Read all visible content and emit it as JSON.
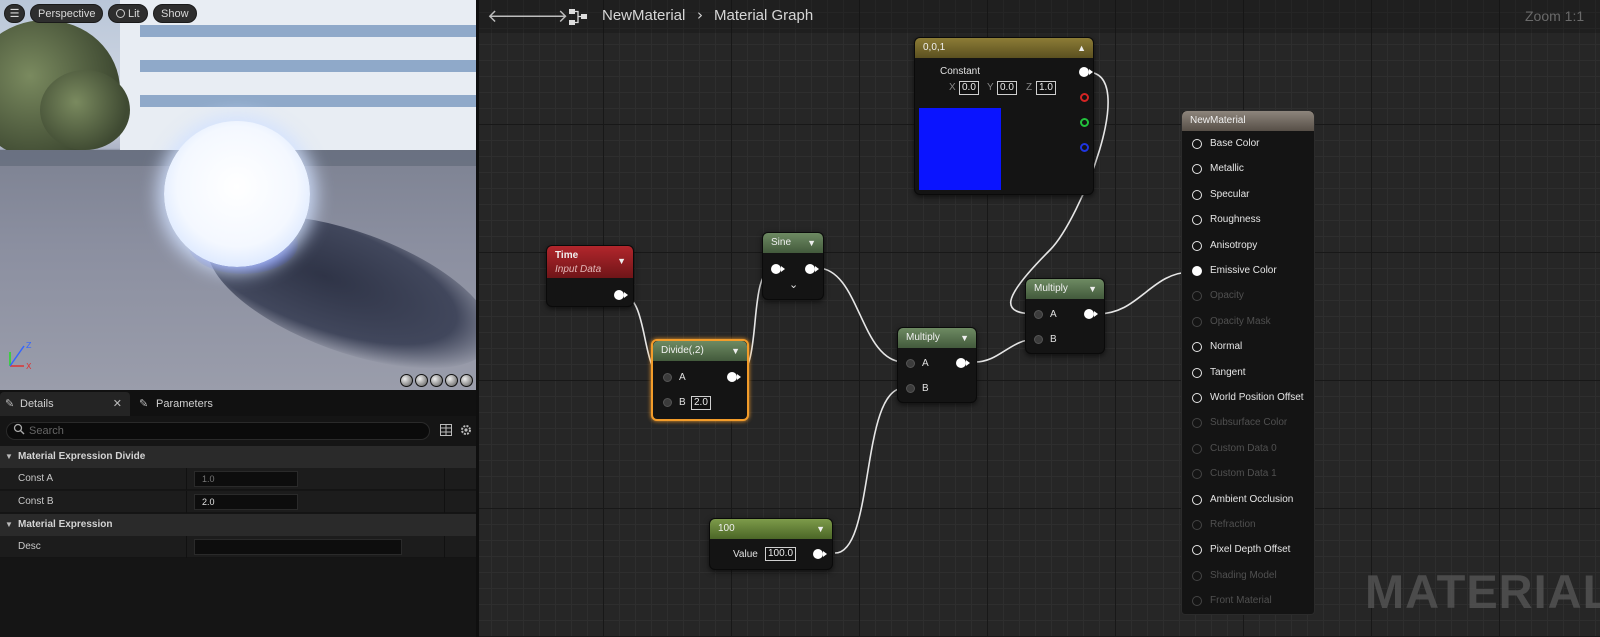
{
  "viewport": {
    "perspective_label": "Perspective",
    "lit_label": "Lit",
    "show_label": "Show",
    "axis_z": "Z",
    "axis_x": "X"
  },
  "details": {
    "tab_details": "Details",
    "tab_parameters": "Parameters",
    "search_placeholder": "Search",
    "categories": [
      {
        "label": "Material Expression Divide",
        "props": [
          {
            "label": "Const A",
            "value": "1.0",
            "muted": true
          },
          {
            "label": "Const B",
            "value": "2.0",
            "muted": false
          }
        ]
      },
      {
        "label": "Material Expression",
        "props": [
          {
            "label": "Desc",
            "value": ""
          }
        ]
      }
    ]
  },
  "graph": {
    "breadcrumb_root": "NewMaterial",
    "breadcrumb_page": "Material Graph",
    "zoom": "Zoom 1:1",
    "watermark": "MATERIAL",
    "nodes": {
      "constant3": {
        "title": "0,0,1",
        "label": "Constant",
        "x": "0.0",
        "y": "0.0",
        "z": "1.0",
        "preview_color": "#0a14ff"
      },
      "time": {
        "title": "Time",
        "subtitle": "Input Data"
      },
      "divide": {
        "title": "Divide(,2)",
        "pin_a": "A",
        "pin_b": "B",
        "b_value": "2.0"
      },
      "sine": {
        "title": "Sine"
      },
      "multiply1": {
        "title": "Multiply",
        "pin_a": "A",
        "pin_b": "B"
      },
      "multiply2": {
        "title": "Multiply",
        "pin_a": "A",
        "pin_b": "B"
      },
      "scalar": {
        "title": "100",
        "label": "Value",
        "value": "100.0"
      }
    },
    "output_node": {
      "title": "NewMaterial",
      "inputs": [
        {
          "label": "Base Color",
          "enabled": true,
          "connected": false
        },
        {
          "label": "Metallic",
          "enabled": true,
          "connected": false
        },
        {
          "label": "Specular",
          "enabled": true,
          "connected": false
        },
        {
          "label": "Roughness",
          "enabled": true,
          "connected": false
        },
        {
          "label": "Anisotropy",
          "enabled": true,
          "connected": false
        },
        {
          "label": "Emissive Color",
          "enabled": true,
          "connected": true
        },
        {
          "label": "Opacity",
          "enabled": false,
          "connected": false
        },
        {
          "label": "Opacity Mask",
          "enabled": false,
          "connected": false
        },
        {
          "label": "Normal",
          "enabled": true,
          "connected": false
        },
        {
          "label": "Tangent",
          "enabled": true,
          "connected": false
        },
        {
          "label": "World Position Offset",
          "enabled": true,
          "connected": false
        },
        {
          "label": "Subsurface Color",
          "enabled": false,
          "connected": false
        },
        {
          "label": "Custom Data 0",
          "enabled": false,
          "connected": false
        },
        {
          "label": "Custom Data 1",
          "enabled": false,
          "connected": false
        },
        {
          "label": "Ambient Occlusion",
          "enabled": true,
          "connected": false
        },
        {
          "label": "Refraction",
          "enabled": false,
          "connected": false
        },
        {
          "label": "Pixel Depth Offset",
          "enabled": true,
          "connected": false
        },
        {
          "label": "Shading Model",
          "enabled": false,
          "connected": false
        },
        {
          "label": "Front Material",
          "enabled": false,
          "connected": false
        }
      ]
    }
  }
}
